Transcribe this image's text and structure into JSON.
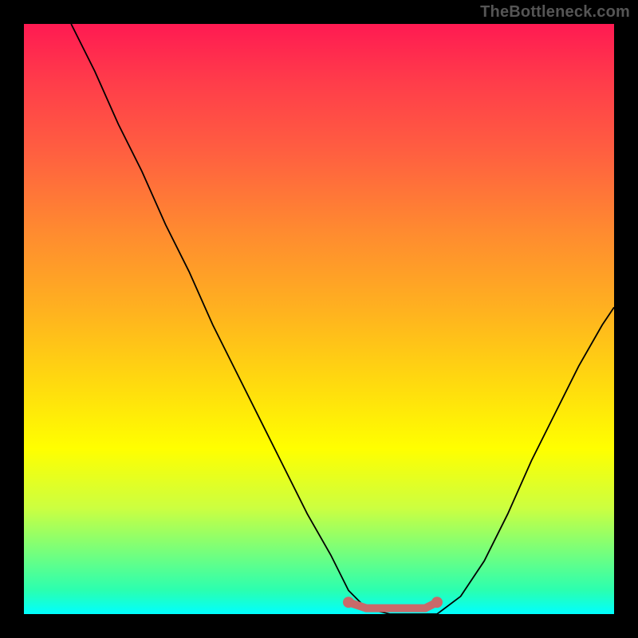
{
  "watermark": "TheBottleneck.com",
  "colors": {
    "frame": "#000000",
    "gradient_top": "#ff1a52",
    "gradient_mid": "#ffff00",
    "gradient_bottom": "#00ffff",
    "curve": "#000000",
    "marker": "#c9696a"
  },
  "chart_data": {
    "type": "line",
    "title": "",
    "xlabel": "",
    "ylabel": "",
    "xlim": [
      0,
      100
    ],
    "ylim": [
      0,
      100
    ],
    "series": [
      {
        "name": "curve",
        "x": [
          8,
          12,
          16,
          20,
          24,
          28,
          32,
          36,
          40,
          44,
          48,
          52,
          55,
          58,
          62,
          66,
          70,
          74,
          78,
          82,
          86,
          90,
          94,
          98,
          100
        ],
        "values": [
          100,
          92,
          83,
          75,
          66,
          58,
          49,
          41,
          33,
          25,
          17,
          10,
          4,
          1,
          0,
          0,
          0,
          3,
          9,
          17,
          26,
          34,
          42,
          49,
          52
        ]
      },
      {
        "name": "markers",
        "x": [
          55,
          58,
          60,
          62,
          64,
          66,
          68,
          70
        ],
        "values": [
          2,
          1,
          1,
          1,
          1,
          1,
          1,
          2
        ]
      }
    ]
  }
}
